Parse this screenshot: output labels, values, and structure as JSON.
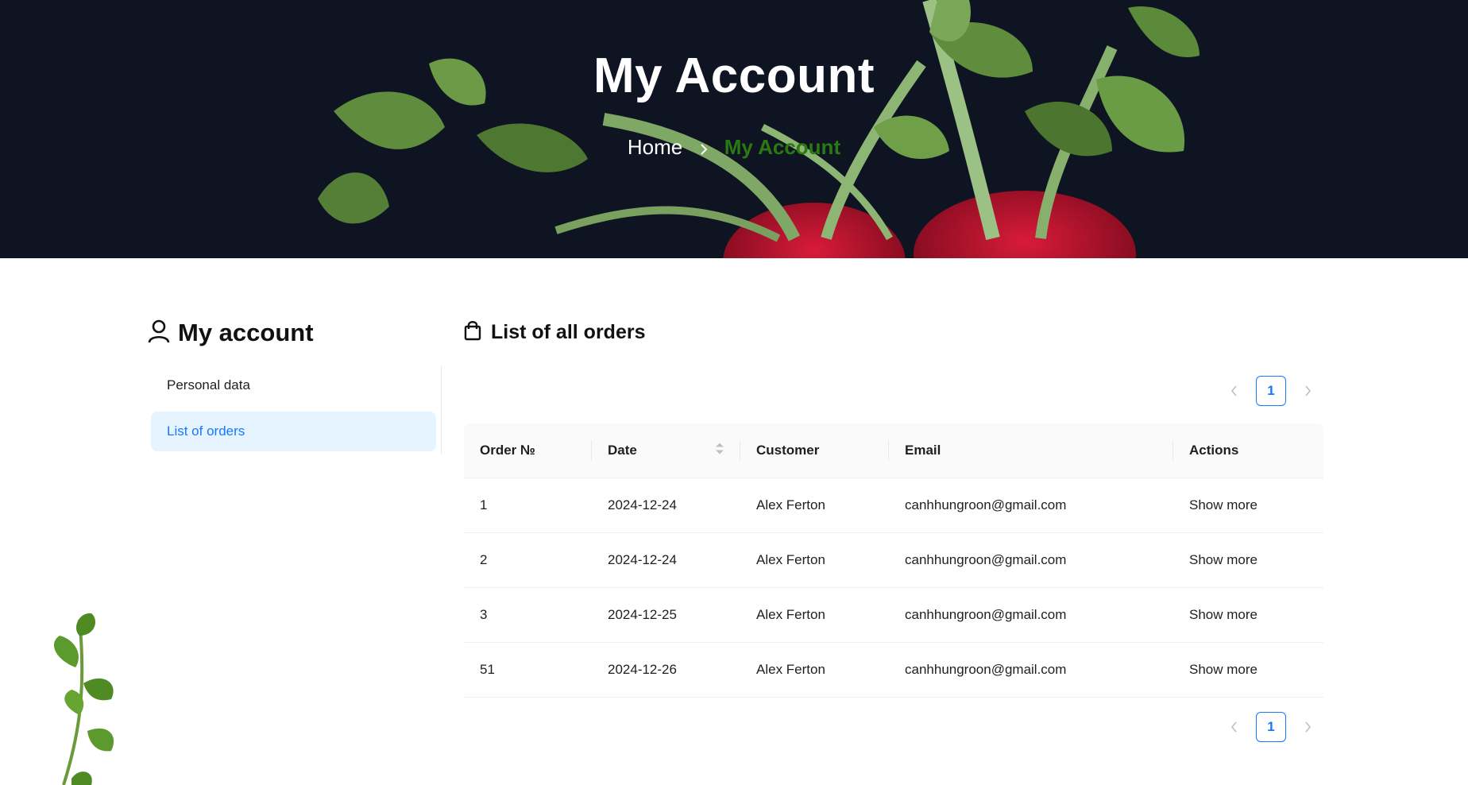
{
  "hero": {
    "title": "My Account",
    "breadcrumb": {
      "home": "Home",
      "current": "My Account"
    }
  },
  "sidebar": {
    "title": "My account",
    "items": [
      {
        "label": "Personal data",
        "active": false
      },
      {
        "label": "List of orders",
        "active": true
      }
    ]
  },
  "main": {
    "title": "List of all orders",
    "pagination": {
      "page": "1"
    },
    "columns": [
      "Order №",
      "Date",
      "Customer",
      "Email",
      "Actions"
    ],
    "rows": [
      {
        "order": "1",
        "date": "2024-12-24",
        "customer": "Alex Ferton",
        "email": "canhhungroon@gmail.com",
        "action": "Show more"
      },
      {
        "order": "2",
        "date": "2024-12-24",
        "customer": "Alex Ferton",
        "email": "canhhungroon@gmail.com",
        "action": "Show more"
      },
      {
        "order": "3",
        "date": "2024-12-25",
        "customer": "Alex Ferton",
        "email": "canhhungroon@gmail.com",
        "action": "Show more"
      },
      {
        "order": "51",
        "date": "2024-12-26",
        "customer": "Alex Ferton",
        "email": "canhhungroon@gmail.com",
        "action": "Show more"
      }
    ]
  },
  "colors": {
    "accent": "#1677ff",
    "breadcrumb_current": "#2a7a14",
    "hero_bg": "#0e1421",
    "active_bg": "#e6f4ff"
  },
  "icons": [
    "user-icon",
    "shopping-bag-icon",
    "chevron-right-icon",
    "chevron-left-icon",
    "sort-icon"
  ]
}
